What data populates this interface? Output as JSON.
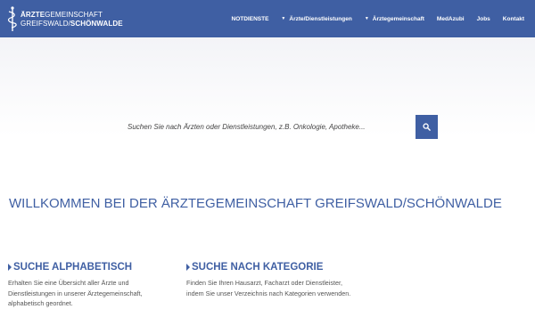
{
  "header": {
    "logo": {
      "line1_bold": "ÄRZTE",
      "line1_rest": "GEMEINSCHAFT",
      "line2_rest": "GREIFSWALD/",
      "line2_bold": "SCHÖNWALDE"
    },
    "nav": [
      {
        "label": "NOTDIENSTE",
        "has_caret": false
      },
      {
        "label": "Ärzte/Dienstleistungen",
        "has_caret": true
      },
      {
        "label": "Ärztegemeinschaft",
        "has_caret": true
      },
      {
        "label": "MedAzubi",
        "has_caret": false
      },
      {
        "label": "Jobs",
        "has_caret": false
      },
      {
        "label": "Kontakt",
        "has_caret": false
      }
    ]
  },
  "search": {
    "placeholder": "Suchen Sie nach Ärzten oder Dienstleistungen, z.B. Onkologie, Apotheke...",
    "button_icon": "search-icon"
  },
  "welcome": {
    "title": "WILLKOMMEN BEI DER ÄRZTEGEMEINSCHAFT GREIFSWALD/SCHÖNWALDE"
  },
  "columns": [
    {
      "title": "SUCHE ALPHABETISCH",
      "text": "Erhalten Sie eine Übersicht aller Ärzte und Dienstleistungen in unserer Ärztegemeinschaft, alphabetisch geordnet."
    },
    {
      "title": "SUCHE NACH KATEGORIE",
      "text": "Finden Sie Ihren Hausarzt, Facharzt oder Dienstleister, indem Sie unser Verzeichnis nach Kategorien verwenden."
    }
  ],
  "colors": {
    "brand": "#3f5fa3",
    "text": "#555555"
  }
}
